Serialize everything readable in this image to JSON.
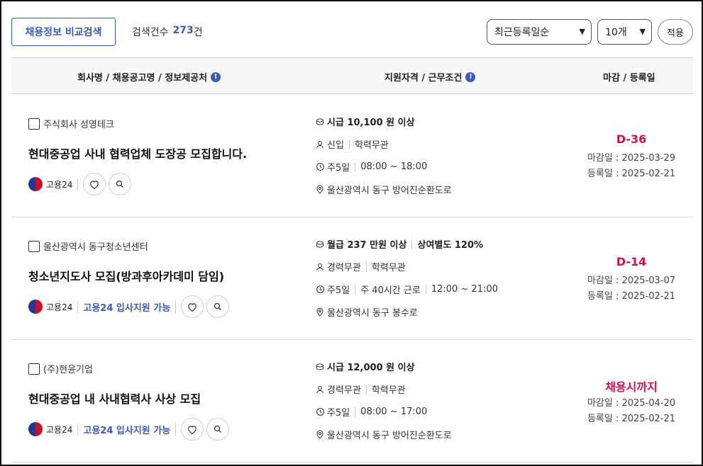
{
  "toolbar": {
    "compare_label": "채용정보 비교검색",
    "count_label": "검색건수",
    "count_value": "273",
    "count_unit": "건",
    "sort_selected": "최근등록일순",
    "size_selected": "10개",
    "apply_label": "적용"
  },
  "table_header": {
    "col1": "회사명 / 채용공고명 / 정보제공처",
    "col2": "지원자격 / 근무조건",
    "col3": "마감 / 등록일",
    "info_glyph": "!"
  },
  "colors": {
    "accent": "#3b5bbd",
    "deadline": "#d2124f"
  },
  "icons": {
    "pay": "coin-icon",
    "person": "person-icon",
    "schedule": "clock-icon",
    "location": "map-pin-icon",
    "like": "heart-icon",
    "search": "search-icon"
  },
  "jobs": [
    {
      "company": "주식회사 성영테크",
      "title": "현대중공업 사내 협력업체 도장공 모집합니다.",
      "source": "고용24",
      "apply_note": "",
      "pay": "시급 10,100 원 이상",
      "pay_extra": "",
      "career": "신입",
      "education": "학력무관",
      "days": "주5일",
      "hours_note": "",
      "hours": "08:00 ~ 18:00",
      "location": "울산광역시 동구 방어진순환도로",
      "dday": "D-36",
      "deadline": "마감일 : 2025-03-29",
      "registered": "등록일 : 2025-02-21"
    },
    {
      "company": "울산광역시 동구청소년센터",
      "title": "청소년지도사 모집(방과후아카데미 담임)",
      "source": "고용24",
      "apply_note": "고용24 입사지원 가능",
      "pay": "월급 237 만원 이상",
      "pay_extra": "상여별도 120%",
      "career": "경력무관",
      "education": "학력무관",
      "days": "주5일",
      "hours_note": "주 40시간 근로",
      "hours": "12:00 ~ 21:00",
      "location": "울산광역시 동구 봉수로",
      "dday": "D-14",
      "deadline": "마감일 : 2025-03-07",
      "registered": "등록일 : 2025-02-21"
    },
    {
      "company": "(주)현윤기업",
      "title": "현대중공업 내 사내협력사 사상 모집",
      "source": "고용24",
      "apply_note": "고용24 입사지원 가능",
      "pay": "시급 12,000 원 이상",
      "pay_extra": "",
      "career": "경력무관",
      "education": "학력무관",
      "days": "주5일",
      "hours_note": "",
      "hours": "08:00 ~ 17:00",
      "location": "울산광역시 동구 방어진순환도로",
      "dday": "채용시까지",
      "deadline": "마감일 : 2025-04-20",
      "registered": "등록일 : 2025-02-21"
    }
  ]
}
